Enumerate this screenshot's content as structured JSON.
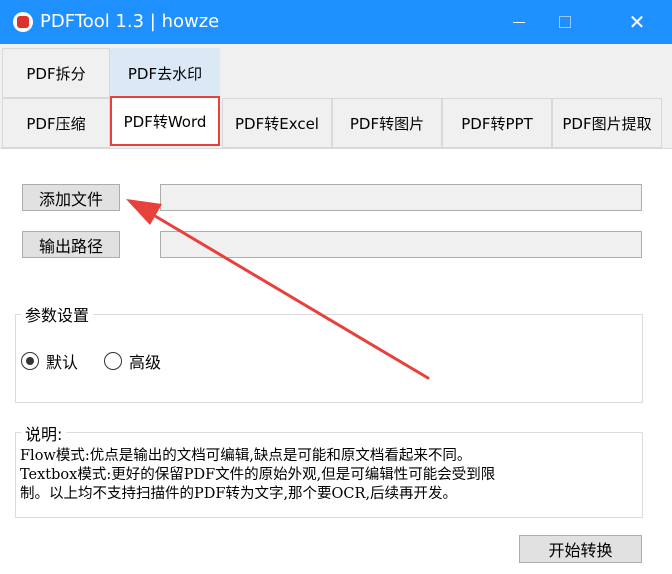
{
  "window": {
    "title": "PDFTool 1.3 |  howze",
    "app_icon": "pdf-app-icon",
    "controls": {
      "minimize": "minimize-icon",
      "maximize": "maximize-icon",
      "close": "✕"
    }
  },
  "tabs_row1": [
    {
      "label": "PDF拆分"
    },
    {
      "label": "PDF去水印"
    }
  ],
  "tabs_row2": [
    {
      "label": "PDF压缩"
    },
    {
      "label": "PDF转Word",
      "selected": true
    },
    {
      "label": "PDF转Excel"
    },
    {
      "label": "PDF转图片"
    },
    {
      "label": "PDF转PPT"
    },
    {
      "label": "PDF图片提取"
    }
  ],
  "main": {
    "add_file_label": "添加文件",
    "add_file_value": "",
    "output_path_label": "输出路径",
    "output_path_value": "",
    "params": {
      "title": "参数设置",
      "options": [
        {
          "label": "默认",
          "checked": true
        },
        {
          "label": "高级",
          "checked": false
        }
      ]
    },
    "description": {
      "title": "说明:",
      "lines": [
        "Flow模式:优点是输出的文档可编辑,缺点是可能和原文档看起来不同。",
        "Textbox模式:更好的保留PDF文件的原始外观,但是可编辑性可能会受到限",
        "制。以上均不支持扫描件的PDF转为文字,那个要OCR,后续再开发。"
      ]
    },
    "start_button_label": "开始转换"
  },
  "colors": {
    "titlebar": "#1e90ff",
    "highlight": "#e8413c",
    "arrow": "#e8413c"
  }
}
